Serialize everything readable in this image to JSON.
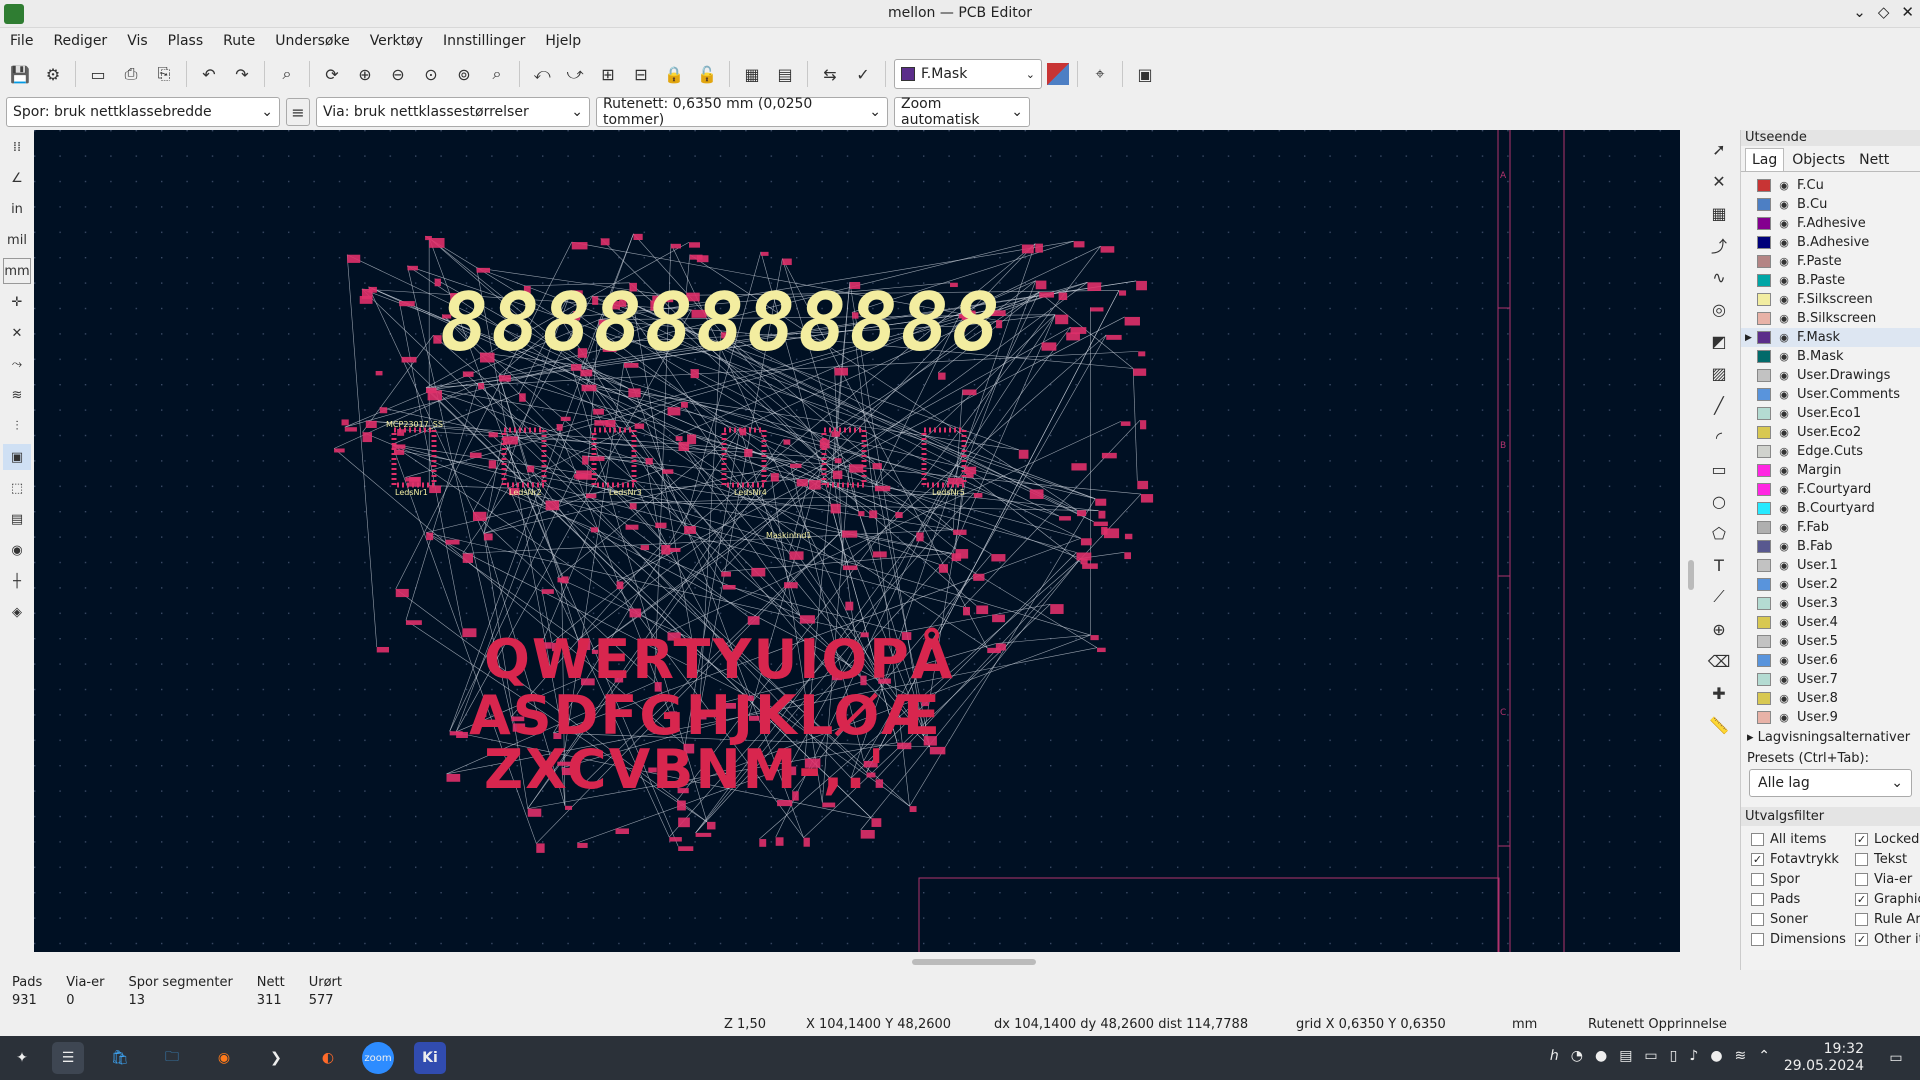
{
  "window": {
    "title": "mellon — PCB Editor"
  },
  "menu": [
    "File",
    "Rediger",
    "Vis",
    "Plass",
    "Rute",
    "Undersøke",
    "Verktøy",
    "Innstillinger",
    "Hjelp"
  ],
  "toolbar": {
    "layer": "F.Mask",
    "layer_color": "#5b2d8a"
  },
  "combos": {
    "track": "Spor: bruk nettklassebredde",
    "via": "Via: bruk nettklassestørrelser",
    "grid": "Rutenett: 0,6350 mm (0,0250 tommer)",
    "zoom": "Zoom automatisk"
  },
  "left_tools": [
    "in",
    "mil",
    "mm"
  ],
  "panel": {
    "header": "Utseende",
    "tabs": [
      "Lag",
      "Objects",
      "Nett"
    ],
    "layers": [
      {
        "name": "F.Cu",
        "color": "#c83434"
      },
      {
        "name": "B.Cu",
        "color": "#4d7fc4"
      },
      {
        "name": "F.Adhesive",
        "color": "#84008f"
      },
      {
        "name": "B.Adhesive",
        "color": "#00007a"
      },
      {
        "name": "F.Paste",
        "color": "#b48585"
      },
      {
        "name": "B.Paste",
        "color": "#00a6a6"
      },
      {
        "name": "F.Silkscreen",
        "color": "#f2eda1"
      },
      {
        "name": "B.Silkscreen",
        "color": "#e8b2a7"
      },
      {
        "name": "F.Mask",
        "color": "#5b2d8a"
      },
      {
        "name": "B.Mask",
        "color": "#026a6a"
      },
      {
        "name": "User.Drawings",
        "color": "#c2c2c2"
      },
      {
        "name": "User.Comments",
        "color": "#5994dc"
      },
      {
        "name": "User.Eco1",
        "color": "#b4dbd2"
      },
      {
        "name": "User.Eco2",
        "color": "#d8c852"
      },
      {
        "name": "Edge.Cuts",
        "color": "#d0d2cd"
      },
      {
        "name": "Margin",
        "color": "#ff26e2"
      },
      {
        "name": "F.Courtyard",
        "color": "#ff26e2"
      },
      {
        "name": "B.Courtyard",
        "color": "#26e9ff"
      },
      {
        "name": "F.Fab",
        "color": "#afafaf"
      },
      {
        "name": "B.Fab",
        "color": "#58588f"
      },
      {
        "name": "User.1",
        "color": "#c2c2c2"
      },
      {
        "name": "User.2",
        "color": "#5994dc"
      },
      {
        "name": "User.3",
        "color": "#b4dbd2"
      },
      {
        "name": "User.4",
        "color": "#d8c852"
      },
      {
        "name": "User.5",
        "color": "#c2c2c2"
      },
      {
        "name": "User.6",
        "color": "#5994dc"
      },
      {
        "name": "User.7",
        "color": "#b4dbd2"
      },
      {
        "name": "User.8",
        "color": "#d8c852"
      },
      {
        "name": "User.9",
        "color": "#e8b2a7"
      }
    ],
    "selected_layer": "F.Mask",
    "layer_options": "Lagvisningsalternativer",
    "presets_label": "Presets (Ctrl+Tab):",
    "presets_value": "Alle lag",
    "filter_header": "Utvalgsfilter",
    "filters": [
      {
        "label": "All items",
        "checked": false
      },
      {
        "label": "Locked it",
        "checked": true
      },
      {
        "label": "Fotavtrykk",
        "checked": true
      },
      {
        "label": "Tekst",
        "checked": false
      },
      {
        "label": "Spor",
        "checked": false
      },
      {
        "label": "Via-er",
        "checked": false
      },
      {
        "label": "Pads",
        "checked": false
      },
      {
        "label": "Graphics",
        "checked": true
      },
      {
        "label": "Soner",
        "checked": false
      },
      {
        "label": "Rule Are",
        "checked": false
      },
      {
        "label": "Dimensions",
        "checked": false
      },
      {
        "label": "Other ite",
        "checked": true
      }
    ]
  },
  "stats": [
    {
      "label": "Pads",
      "value": "931"
    },
    {
      "label": "Via-er",
      "value": "0"
    },
    {
      "label": "Spor segmenter",
      "value": "13"
    },
    {
      "label": "Nett",
      "value": "311"
    },
    {
      "label": "Urørt",
      "value": "577"
    }
  ],
  "status": {
    "zoom": "Z 1,50",
    "pos": "X 104,1400  Y 48,2600",
    "delta": "dx 104,1400  dy 48,2600  dist 114,7788",
    "grid": "grid X 0,6350  Y 0,6350",
    "units": "mm",
    "origin": "Rutenett Opprinnelse"
  },
  "canvas": {
    "digits": "88888888888",
    "keyboard_rows": [
      "QWERTYUIOPÅ",
      "ASDFGHJKLØÆ",
      "ZXCVBNM-,.'"
    ],
    "components": [
      "LedsNr1",
      "LedsNr2",
      "LedsNr3",
      "LedsNr4",
      "LedsNr5",
      "MaskinInd1",
      "MCP23017_SS"
    ],
    "sheet_letters": [
      "A",
      "B",
      "C"
    ]
  },
  "taskbar": {
    "time": "19:32",
    "date": "29.05.2024",
    "apps": [
      "zoom",
      "Ki"
    ]
  }
}
